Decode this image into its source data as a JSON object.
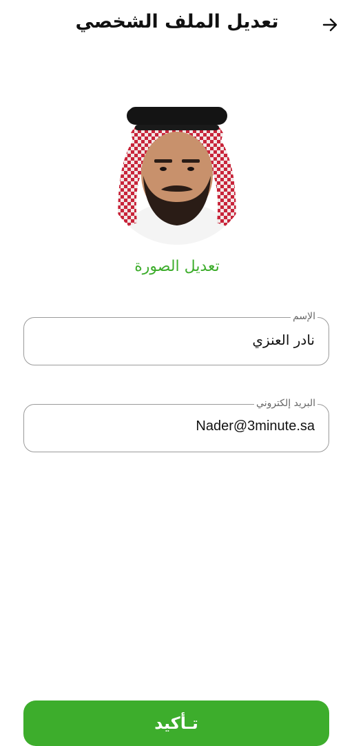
{
  "header": {
    "title": "تعديل الملف الشخصي",
    "back_icon": "arrow-right-icon"
  },
  "profile": {
    "avatar_icon": "user-photo",
    "change_photo_label": "تعديل الصورة"
  },
  "form": {
    "name_label": "الإسم",
    "name_value": "نادر العنزي",
    "email_label": "البريد إلكتروني",
    "email_value": "Nader@3minute.sa"
  },
  "actions": {
    "confirm_label": "تـأكيد"
  },
  "colors": {
    "accent": "#3dad2c",
    "border": "#9a9a9a"
  }
}
